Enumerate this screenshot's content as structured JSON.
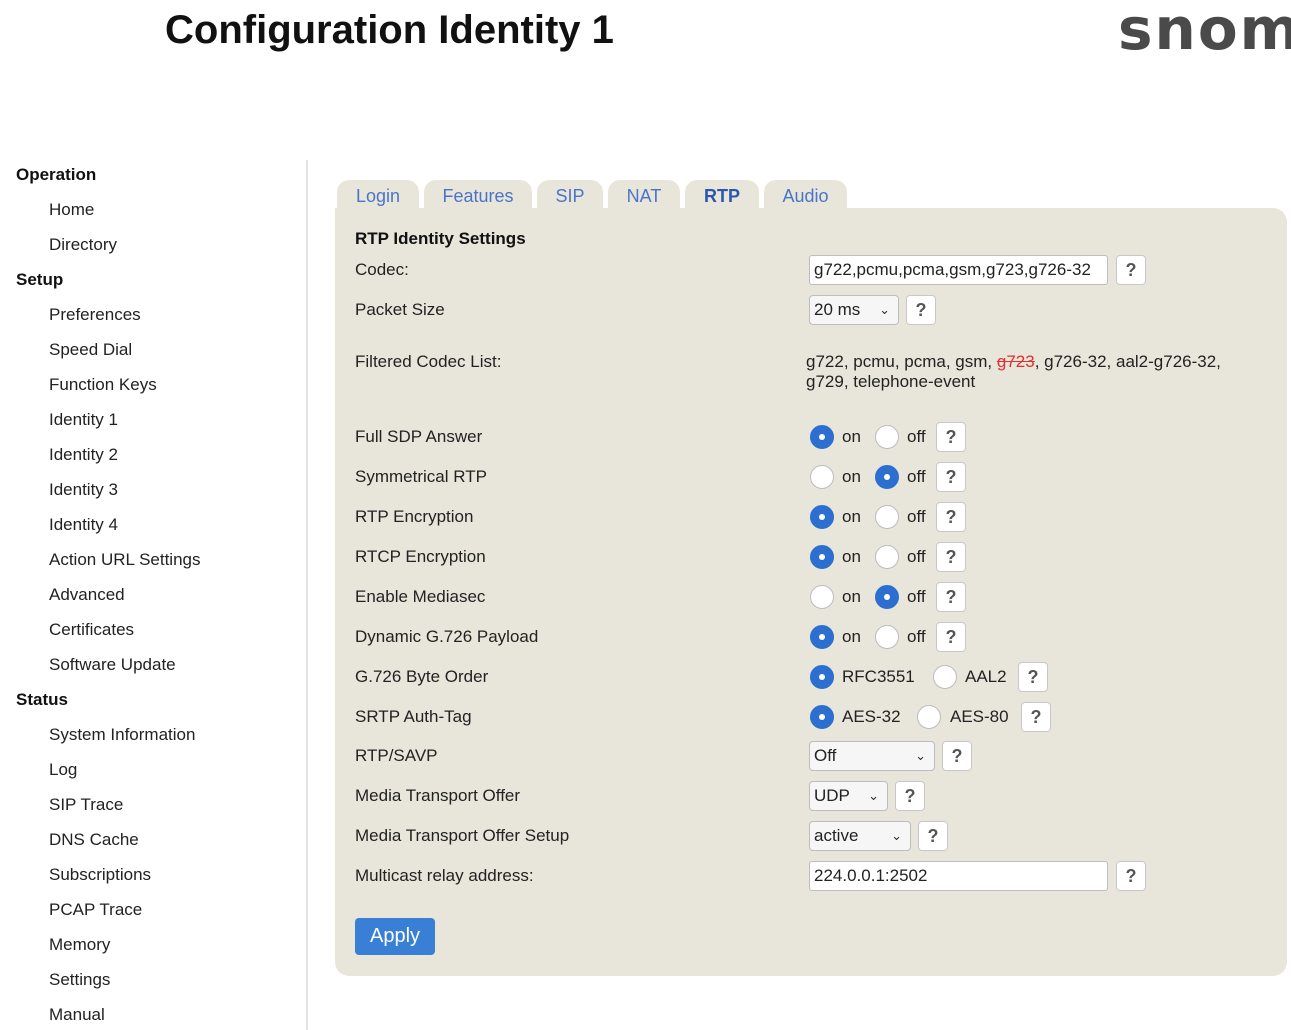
{
  "header": {
    "title": "Configuration Identity 1",
    "logo": "snom"
  },
  "sidebar": {
    "sections": [
      {
        "label": "Operation",
        "items": [
          "Home",
          "Directory"
        ]
      },
      {
        "label": "Setup",
        "items": [
          "Preferences",
          "Speed Dial",
          "Function Keys",
          "Identity 1",
          "Identity 2",
          "Identity 3",
          "Identity 4",
          "Action URL Settings",
          "Advanced",
          "Certificates",
          "Software Update"
        ]
      },
      {
        "label": "Status",
        "items": [
          "System Information",
          "Log",
          "SIP Trace",
          "DNS Cache",
          "Subscriptions",
          "PCAP Trace",
          "Memory",
          "Settings",
          "Manual"
        ]
      }
    ]
  },
  "tabs": [
    "Login",
    "Features",
    "SIP",
    "NAT",
    "RTP",
    "Audio"
  ],
  "active_tab": "RTP",
  "form": {
    "section_title": "RTP Identity Settings",
    "codec": {
      "label": "Codec:",
      "value": "g722,pcmu,pcma,gsm,g723,g726-32"
    },
    "packet_size": {
      "label": "Packet Size",
      "value": "20 ms"
    },
    "filtered": {
      "label": "Filtered Codec List:",
      "before": "g722, pcmu, pcma, gsm, ",
      "struck": "g723",
      "after": ", g726-32, aal2-g726-32, g729, telephone-event"
    },
    "radio_rows": [
      {
        "label": "Full SDP Answer",
        "opt1": "on",
        "opt2": "off",
        "selected": 1
      },
      {
        "label": "Symmetrical RTP",
        "opt1": "on",
        "opt2": "off",
        "selected": 2
      },
      {
        "label": "RTP Encryption",
        "opt1": "on",
        "opt2": "off",
        "selected": 1
      },
      {
        "label": "RTCP Encryption",
        "opt1": "on",
        "opt2": "off",
        "selected": 1
      },
      {
        "label": "Enable Mediasec",
        "opt1": "on",
        "opt2": "off",
        "selected": 2
      },
      {
        "label": "Dynamic G.726 Payload",
        "opt1": "on",
        "opt2": "off",
        "selected": 1
      },
      {
        "label": "G.726 Byte Order",
        "opt1": "RFC3551",
        "opt2": "AAL2",
        "selected": 1
      },
      {
        "label": "SRTP Auth-Tag",
        "opt1": "AES-32",
        "opt2": "AES-80",
        "selected": 1
      }
    ],
    "rtp_savp": {
      "label": "RTP/SAVP",
      "value": "Off"
    },
    "media_transport_offer": {
      "label": "Media Transport Offer",
      "value": "UDP"
    },
    "media_transport_offer_setup": {
      "label": "Media Transport Offer Setup",
      "value": "active"
    },
    "multicast": {
      "label": "Multicast relay address:",
      "value": "224.0.0.1:2502"
    },
    "help_label": "?",
    "apply_label": "Apply"
  }
}
